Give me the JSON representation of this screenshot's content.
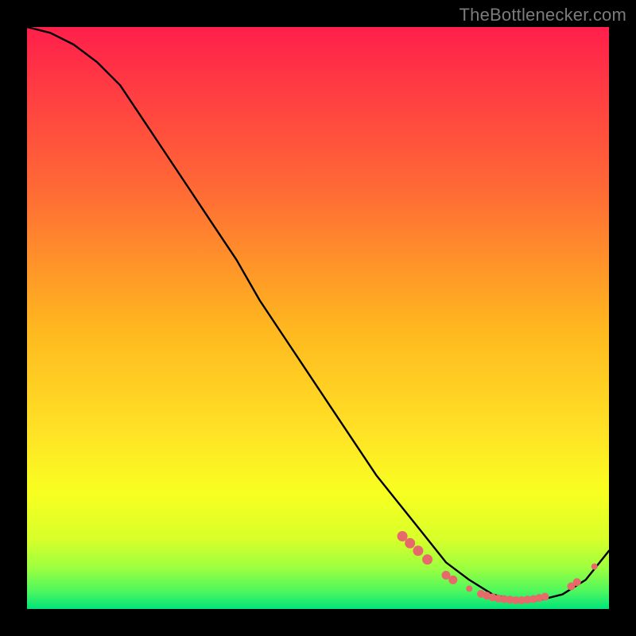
{
  "watermark": "TheBottlenecker.com",
  "chart_data": {
    "type": "line",
    "title": "",
    "xlabel": "",
    "ylabel": "",
    "xlim": [
      0,
      100
    ],
    "ylim": [
      0,
      100
    ],
    "grid": false,
    "background_gradient": [
      "#ff1f4b",
      "#ff8a2a",
      "#ffe326",
      "#f8ff20",
      "#b6ff3a",
      "#00e37a"
    ],
    "series": [
      {
        "name": "curve",
        "x": [
          0,
          4,
          8,
          12,
          16,
          20,
          24,
          28,
          32,
          36,
          40,
          44,
          48,
          52,
          56,
          60,
          64,
          68,
          72,
          76,
          80,
          84,
          88,
          92,
          96,
          100
        ],
        "y": [
          100,
          99,
          97,
          94,
          90,
          84,
          78,
          72,
          66,
          60,
          53,
          47,
          41,
          35,
          29,
          23,
          18,
          13,
          8,
          5,
          2.5,
          1.5,
          1.5,
          2.5,
          5,
          10
        ],
        "color": "#000000"
      }
    ],
    "markers": [
      {
        "x": 64.5,
        "y": 12.5,
        "r": 6.5,
        "c": "#e76a6a"
      },
      {
        "x": 65.8,
        "y": 11.3,
        "r": 6.5,
        "c": "#e76a6a"
      },
      {
        "x": 67.2,
        "y": 10.0,
        "r": 6.5,
        "c": "#e76a6a"
      },
      {
        "x": 68.8,
        "y": 8.5,
        "r": 6.5,
        "c": "#e76a6a"
      },
      {
        "x": 72.0,
        "y": 5.8,
        "r": 5.5,
        "c": "#e76a6a"
      },
      {
        "x": 73.2,
        "y": 5.0,
        "r": 5.5,
        "c": "#e76a6a"
      },
      {
        "x": 76.0,
        "y": 3.5,
        "r": 4.0,
        "c": "#e76a6a"
      },
      {
        "x": 78.0,
        "y": 2.6,
        "r": 5.0,
        "c": "#e76a6a"
      },
      {
        "x": 79.0,
        "y": 2.3,
        "r": 5.0,
        "c": "#e76a6a"
      },
      {
        "x": 80.0,
        "y": 2.0,
        "r": 5.0,
        "c": "#e76a6a"
      },
      {
        "x": 81.0,
        "y": 1.8,
        "r": 5.0,
        "c": "#e76a6a"
      },
      {
        "x": 82.0,
        "y": 1.7,
        "r": 5.0,
        "c": "#e76a6a"
      },
      {
        "x": 83.0,
        "y": 1.6,
        "r": 5.0,
        "c": "#e76a6a"
      },
      {
        "x": 84.0,
        "y": 1.5,
        "r": 5.0,
        "c": "#e76a6a"
      },
      {
        "x": 85.0,
        "y": 1.5,
        "r": 5.0,
        "c": "#e76a6a"
      },
      {
        "x": 86.0,
        "y": 1.6,
        "r": 5.0,
        "c": "#e76a6a"
      },
      {
        "x": 87.0,
        "y": 1.7,
        "r": 5.0,
        "c": "#e76a6a"
      },
      {
        "x": 88.0,
        "y": 1.9,
        "r": 5.0,
        "c": "#e76a6a"
      },
      {
        "x": 89.0,
        "y": 2.1,
        "r": 5.0,
        "c": "#e76a6a"
      },
      {
        "x": 93.5,
        "y": 3.9,
        "r": 5.0,
        "c": "#e76a6a"
      },
      {
        "x": 94.5,
        "y": 4.6,
        "r": 5.0,
        "c": "#e76a6a"
      },
      {
        "x": 97.5,
        "y": 7.3,
        "r": 4.0,
        "c": "#e76a6a"
      }
    ]
  }
}
